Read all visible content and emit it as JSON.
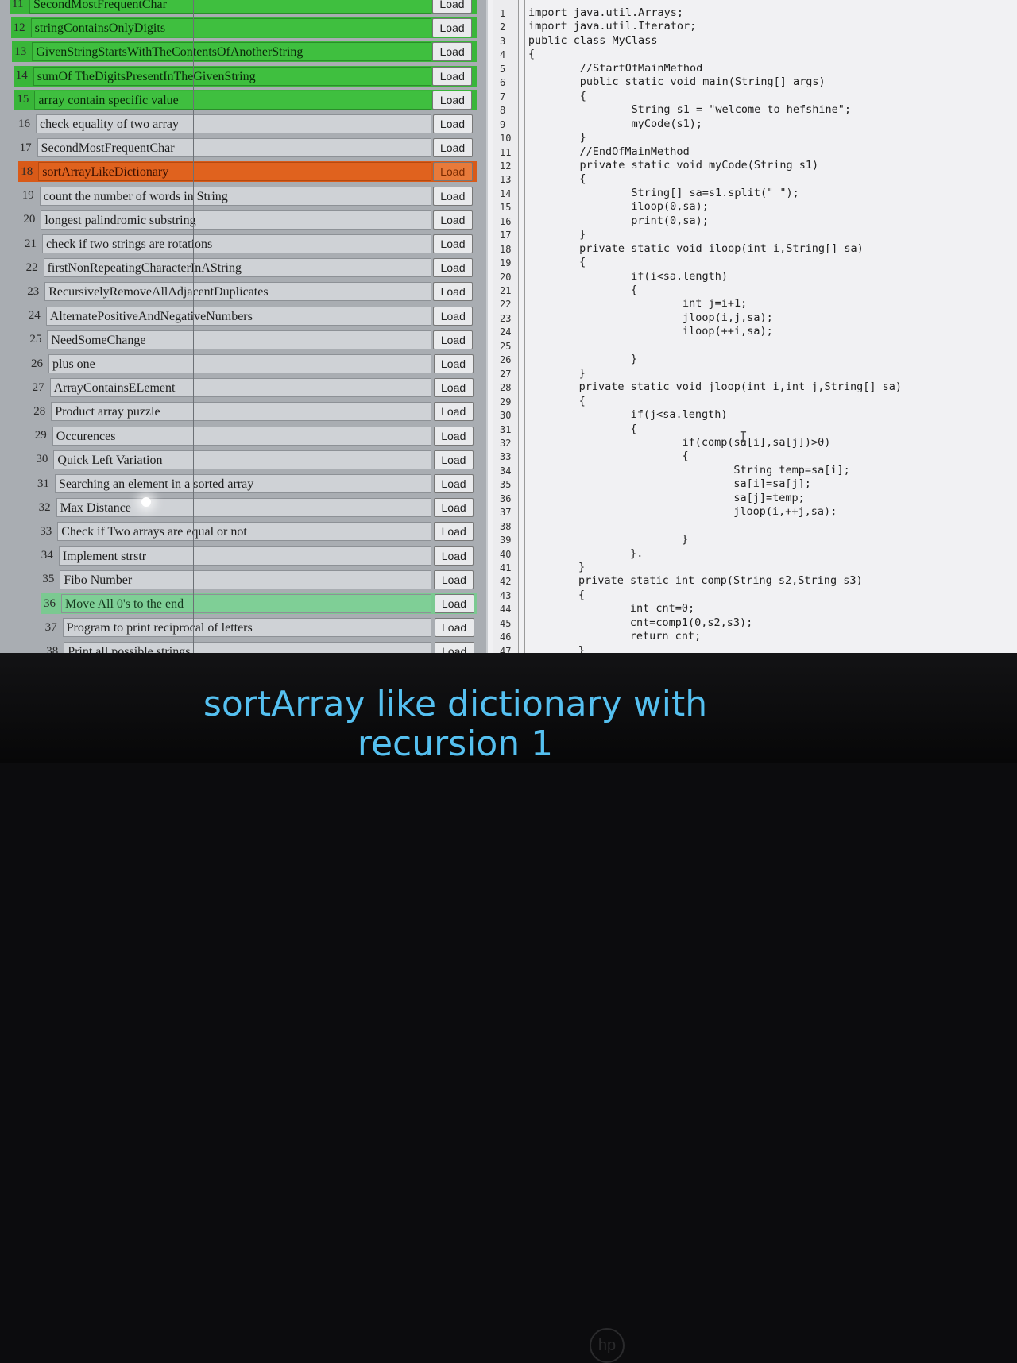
{
  "problem_list": {
    "load_label": "Load",
    "items": [
      {
        "num": "11",
        "title": "SecondMostFrequentChar",
        "state": "green"
      },
      {
        "num": "12",
        "title": "stringContainsOnlyDigits",
        "state": "green"
      },
      {
        "num": "13",
        "title": "GivenStringStartsWithTheContentsOfAnotherString",
        "state": "green"
      },
      {
        "num": "14",
        "title": "sumOf TheDigitsPresentInTheGivenString",
        "state": "green"
      },
      {
        "num": "15",
        "title": "array contain specific value",
        "state": "green"
      },
      {
        "num": "16",
        "title": "check equality of two array",
        "state": "normal"
      },
      {
        "num": "17",
        "title": "SecondMostFrequentChar",
        "state": "normal"
      },
      {
        "num": "18",
        "title": "sortArrayLikeDictionary",
        "state": "active"
      },
      {
        "num": "19",
        "title": "count the number of words in String",
        "state": "normal"
      },
      {
        "num": "20",
        "title": "longest palindromic substring",
        "state": "normal"
      },
      {
        "num": "21",
        "title": "check if two strings are rotations",
        "state": "normal"
      },
      {
        "num": "22",
        "title": "firstNonRepeatingCharacterInAString",
        "state": "normal"
      },
      {
        "num": "23",
        "title": "RecursivelyRemoveAllAdjacentDuplicates",
        "state": "normal"
      },
      {
        "num": "24",
        "title": "AlternatePositiveAndNegativeNumbers",
        "state": "normal"
      },
      {
        "num": "25",
        "title": "NeedSomeChange",
        "state": "normal"
      },
      {
        "num": "26",
        "title": "plus one",
        "state": "normal"
      },
      {
        "num": "27",
        "title": "ArrayContainsELement",
        "state": "normal"
      },
      {
        "num": "28",
        "title": "Product array puzzle",
        "state": "normal"
      },
      {
        "num": "29",
        "title": "Occurences",
        "state": "normal"
      },
      {
        "num": "30",
        "title": "Quick Left Variation",
        "state": "normal"
      },
      {
        "num": "31",
        "title": "Searching an element in a sorted array",
        "state": "normal"
      },
      {
        "num": "32",
        "title": "Max Distance",
        "state": "normal"
      },
      {
        "num": "33",
        "title": "Check if Two arrays are equal or not",
        "state": "normal"
      },
      {
        "num": "34",
        "title": "Implement strstr",
        "state": "normal"
      },
      {
        "num": "35",
        "title": "Fibo Number",
        "state": "normal"
      },
      {
        "num": "36",
        "title": "Move All 0's to the end",
        "state": "mint"
      },
      {
        "num": "37",
        "title": "Program to print reciprocal of letters",
        "state": "normal"
      },
      {
        "num": "38",
        "title": "Print all possible strings",
        "state": "normal"
      }
    ]
  },
  "editor": {
    "line_numbers": [
      "1",
      "2",
      "3",
      "4",
      "5",
      "6",
      "7",
      "8",
      "9",
      "10",
      "11",
      "12",
      "13",
      "14",
      "15",
      "16",
      "17",
      "18",
      "19",
      "20",
      "21",
      "22",
      "23",
      "24",
      "25",
      "26",
      "27",
      "28",
      "29",
      "30",
      "31",
      "32",
      "33",
      "34",
      "35",
      "36",
      "37",
      "38",
      "39",
      "40",
      "41",
      "42",
      "43",
      "44",
      "45",
      "46",
      "47"
    ],
    "lines": [
      "import java.util.Arrays;",
      "import java.util.Iterator;",
      "public class MyClass",
      "{",
      "        //StartOfMainMethod",
      "        public static void main(String[] args)",
      "        {",
      "                String s1 = \"welcome to hefshine\";",
      "                myCode(s1);",
      "        }",
      "        //EndOfMainMethod",
      "        private static void myCode(String s1)",
      "        {",
      "                String[] sa=s1.split(\" \");",
      "                iloop(0,sa);",
      "                print(0,sa);",
      "        }",
      "        private static void iloop(int i,String[] sa)",
      "        {",
      "                if(i<sa.length)",
      "                {",
      "                        int j=i+1;",
      "                        jloop(i,j,sa);",
      "                        iloop(++i,sa);",
      "",
      "                }",
      "        }",
      "        private static void jloop(int i,int j,String[] sa)",
      "        {",
      "                if(j<sa.length)",
      "                {",
      "                        if(comp(sa[i],sa[j])>0)",
      "                        {",
      "                                String temp=sa[i];",
      "                                sa[i]=sa[j];",
      "                                sa[j]=temp;",
      "                                jloop(i,++j,sa);",
      "",
      "                        }",
      "                }.",
      "        }",
      "        private static int comp(String s2,String s3)",
      "        {",
      "                int cnt=0;",
      "                cnt=comp1(0,s2,s3);",
      "                return cnt;",
      "        }"
    ]
  },
  "caption": {
    "line1": "sortArray like dictionary with",
    "line2": "recursion 1"
  },
  "colors": {
    "solved_green": "#3fbf3f",
    "active_orange": "#e0621e",
    "partial_mint": "#7fcf96",
    "caption_blue": "#55c0f0"
  }
}
